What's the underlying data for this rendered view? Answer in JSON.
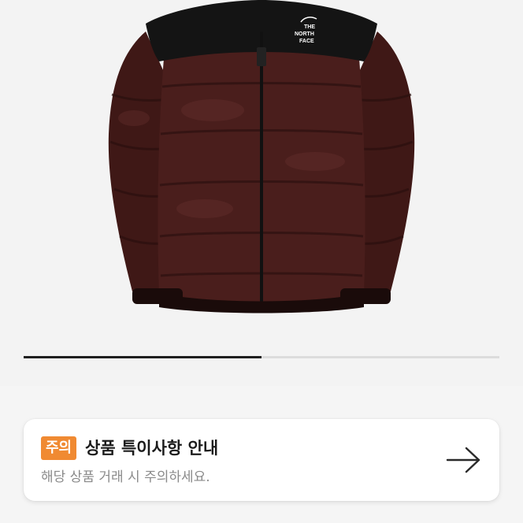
{
  "product": {
    "image_alt": "brown puffer jacket",
    "brand_logo_lines": [
      "THE",
      "NORTH",
      "FACE"
    ],
    "gallery_progress": 0.5
  },
  "notice": {
    "badge_label": "주의",
    "title": "상품 특이사항 안내",
    "subtitle": "해당 상품 거래 시 주의하세요.",
    "arrow_icon": "arrow-right-icon"
  },
  "colors": {
    "badge": "#f08a32",
    "jacket_body": "#4a1e1c",
    "jacket_shoulder": "#141414",
    "progress_fill": "#1f1f1f",
    "progress_track": "#dcdcdc"
  }
}
